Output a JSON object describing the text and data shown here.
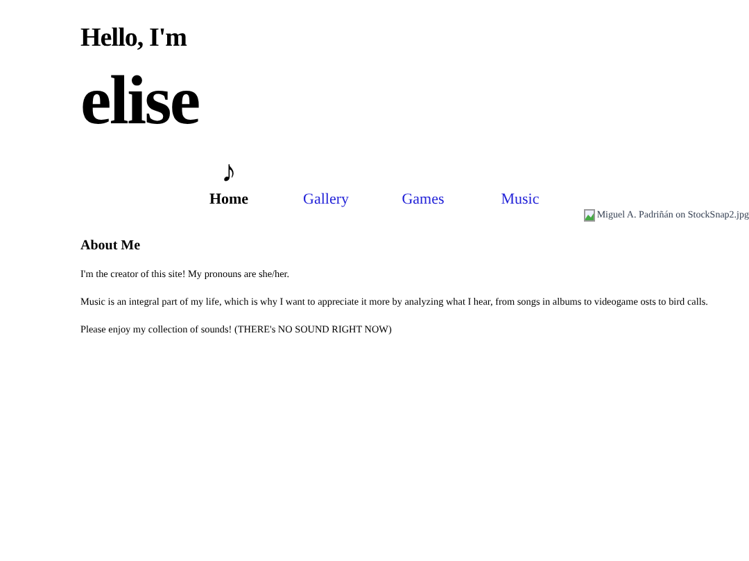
{
  "greeting": "Hello, I'm",
  "name": "elise",
  "nav": [
    {
      "label": "Home",
      "icon": "♪",
      "selected": true
    },
    {
      "label": "Gallery",
      "selected": false
    },
    {
      "label": "Games",
      "selected": false
    },
    {
      "label": "Music",
      "selected": false
    }
  ],
  "image_alt": "Miguel A. Padriñán on StockSnap2.jpg",
  "about": {
    "heading": "About Me",
    "paragraphs": [
      "I'm the creator of this site! My pronouns are she/her.",
      "Music is an integral part of my life, which is why I want to appreciate it more by analyzing what I hear, from songs in albums to videogame osts to bird calls.",
      "Please enjoy my collection of sounds! (THERE's NO SOUND RIGHT NOW)"
    ]
  }
}
